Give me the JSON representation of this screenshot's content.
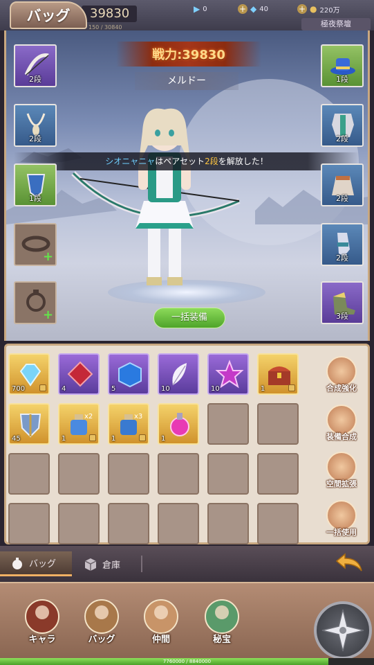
{
  "header": {
    "tab_title": "バッグ",
    "power_value": "39830",
    "sub_power": "150 / 30840",
    "res1_value": "0",
    "res2_value": "40",
    "res3_value": "220万",
    "event_label": "極夜祭壇"
  },
  "character": {
    "power_label": "戦力:39830",
    "name": "メルドー",
    "notice_name": "シオニャニャ",
    "notice_mid": "はペアセット",
    "notice_level": "2段",
    "notice_end": "を解放した！",
    "equip_all": "一括装備"
  },
  "left_slots": [
    {
      "level": "2段",
      "icon": "bow-icon",
      "rarity": "purple"
    },
    {
      "level": "2段",
      "icon": "necklace-icon",
      "rarity": "blue"
    },
    {
      "level": "1段",
      "icon": "emblem-icon",
      "rarity": "green"
    },
    {
      "level": "",
      "icon": "bracelet-icon",
      "rarity": "empty"
    },
    {
      "level": "",
      "icon": "ring-icon",
      "rarity": "empty"
    }
  ],
  "right_slots": [
    {
      "level": "1段",
      "icon": "hat-icon",
      "rarity": "green"
    },
    {
      "level": "2段",
      "icon": "armor-icon",
      "rarity": "blue"
    },
    {
      "level": "2段",
      "icon": "skirt-icon",
      "rarity": "blue"
    },
    {
      "level": "2段",
      "icon": "gloves-icon",
      "rarity": "blue"
    },
    {
      "level": "3段",
      "icon": "boots-icon",
      "rarity": "purple"
    }
  ],
  "inventory": [
    {
      "count": "700",
      "icon": "diamond-icon",
      "rarity": "gold",
      "locked": true
    },
    {
      "count": "4",
      "icon": "red-gem-icon",
      "rarity": "purple",
      "locked": false
    },
    {
      "count": "5",
      "icon": "blue-cube-icon",
      "rarity": "purple",
      "locked": false
    },
    {
      "count": "10",
      "icon": "feather-icon",
      "rarity": "purple",
      "locked": false
    },
    {
      "count": "10",
      "icon": "star-crystal-icon",
      "rarity": "purple",
      "locked": false
    },
    {
      "count": "1",
      "icon": "treasure-chest-icon",
      "rarity": "gold",
      "locked": true
    },
    {
      "count": "45",
      "icon": "shield-icon",
      "rarity": "gold",
      "locked": false
    },
    {
      "count": "1",
      "icon": "potion-x2-icon",
      "rarity": "gold",
      "locked": true
    },
    {
      "count": "1",
      "icon": "potion-x3-icon",
      "rarity": "gold",
      "locked": true
    },
    {
      "count": "1",
      "icon": "pink-potion-icon",
      "rarity": "gold",
      "locked": false
    }
  ],
  "side_buttons": [
    {
      "label": "合成強化",
      "icon": "hammer-icon"
    },
    {
      "label": "装備合成",
      "icon": "anvil-icon"
    },
    {
      "label": "空間拡張",
      "icon": "expand-icon"
    },
    {
      "label": "一括使用",
      "icon": "checkbox-icon"
    }
  ],
  "bottom_tabs": {
    "bag": "バッグ",
    "storage": "倉庫"
  },
  "nav": [
    {
      "label": "キャラ",
      "icon": "character-icon"
    },
    {
      "label": "バッグ",
      "icon": "backpack-icon"
    },
    {
      "label": "仲間",
      "icon": "companion-icon"
    },
    {
      "label": "秘宝",
      "icon": "treasure-book-icon"
    }
  ],
  "xp": {
    "text": "7760000 / 8840000",
    "fraction": 0.878
  },
  "colors": {
    "accent": "#f0b064",
    "equip_green": "#6cc044"
  }
}
